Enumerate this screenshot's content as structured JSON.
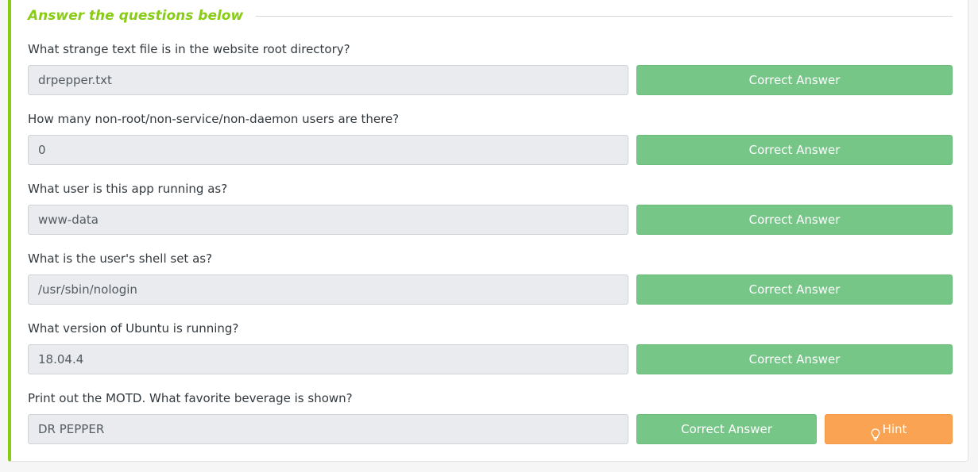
{
  "section": {
    "heading": "Answer the questions below"
  },
  "questions": [
    {
      "text": "What strange text file is in the website root directory?",
      "answer": "drpepper.txt",
      "button": "Correct Answer"
    },
    {
      "text": "How many non-root/non-service/non-daemon users are there?",
      "answer": "0",
      "button": "Correct Answer"
    },
    {
      "text": "What user is this app running as?",
      "answer": "www-data",
      "button": "Correct Answer"
    },
    {
      "text": "What is the user's shell set as?",
      "answer": "/usr/sbin/nologin",
      "button": "Correct Answer"
    },
    {
      "text": "What version of Ubuntu is running?",
      "answer": "18.04.4",
      "button": "Correct Answer"
    },
    {
      "text": "Print out the MOTD.  What favorite beverage is shown?",
      "answer": "DR PEPPER",
      "button": "Correct Answer",
      "hint": "Hint",
      "hint_icon": "lightbulb-icon"
    }
  ],
  "colors": {
    "accent": "#88cc14",
    "correct": "#75c687",
    "hint": "#f9a353",
    "input_bg": "#e9ebee"
  }
}
